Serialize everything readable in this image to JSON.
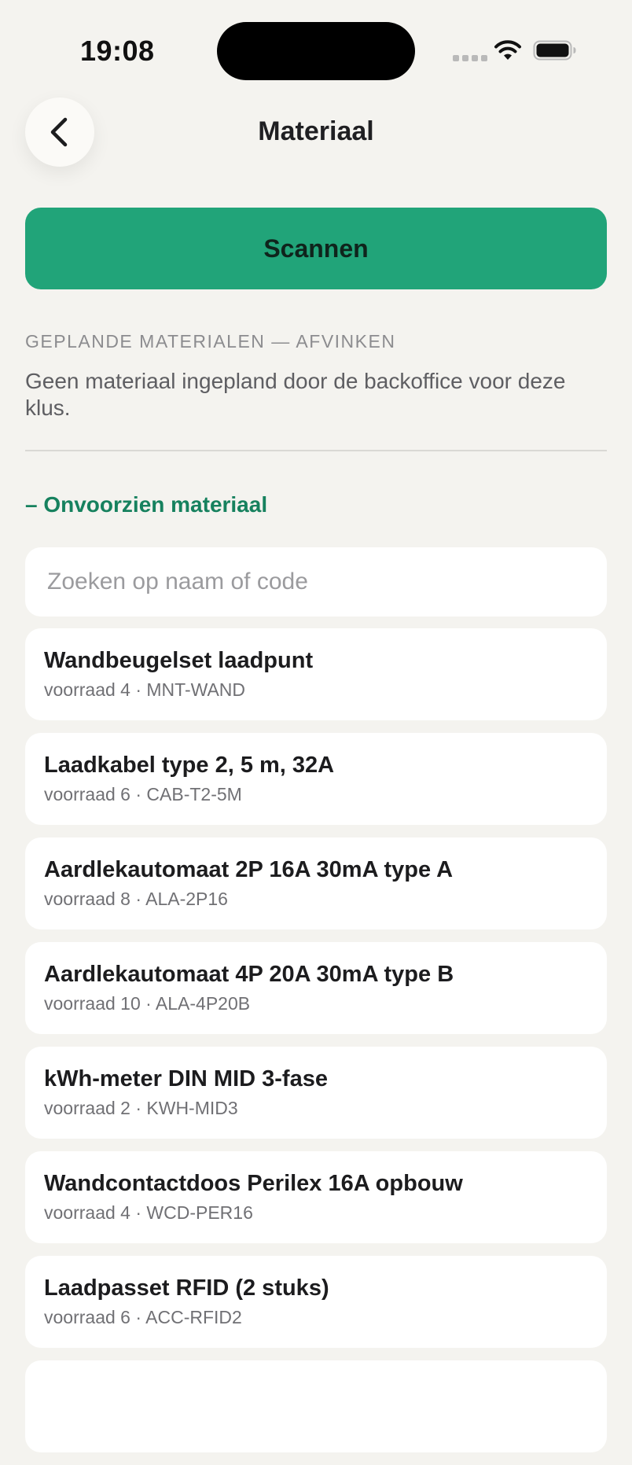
{
  "status_bar": {
    "time": "19:08"
  },
  "header": {
    "title": "Materiaal",
    "back_icon": "chevron-left-icon"
  },
  "scan_button": {
    "label": "Scannen"
  },
  "planned": {
    "section_label": "GEPLANDE MATERIALEN — AFVINKEN",
    "empty_text": "Geen materiaal ingepland door de backoffice voor deze klus."
  },
  "unplanned": {
    "toggle_label": "– Onvoorzien materiaal",
    "search_placeholder": "Zoeken op naam of code"
  },
  "materials": [
    {
      "name": "Wandbeugelset laadpunt",
      "meta": "voorraad 4 · MNT-WAND"
    },
    {
      "name": "Laadkabel type 2, 5 m, 32A",
      "meta": "voorraad 6 · CAB-T2-5M"
    },
    {
      "name": "Aardlekautomaat 2P 16A 30mA type A",
      "meta": "voorraad 8 · ALA-2P16"
    },
    {
      "name": "Aardlekautomaat 4P 20A 30mA type B",
      "meta": "voorraad 10 · ALA-4P20B"
    },
    {
      "name": "kWh-meter DIN MID 3-fase",
      "meta": "voorraad 2 · KWH-MID3"
    },
    {
      "name": "Wandcontactdoos Perilex 16A opbouw",
      "meta": "voorraad 4 · WCD-PER16"
    },
    {
      "name": "Laadpasset RFID (2 stuks)",
      "meta": "voorraad 6 · ACC-RFID2"
    },
    {
      "name": "",
      "meta": ""
    }
  ],
  "colors": {
    "background": "#f4f3ef",
    "accent": "#21a479",
    "accent_text": "#16815e"
  }
}
